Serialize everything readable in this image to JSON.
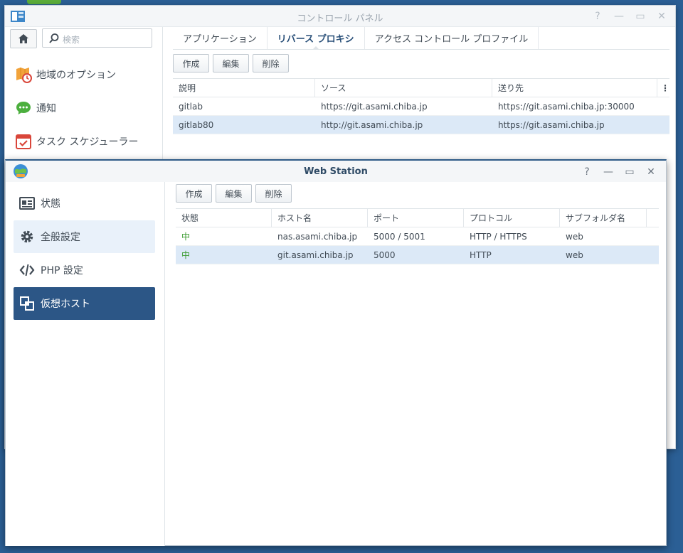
{
  "control_panel": {
    "title": "コントロール パネル",
    "search_placeholder": "検索",
    "window_controls": [
      "?",
      "—",
      "▭",
      "✕"
    ],
    "sidebar": [
      {
        "label": "地域のオプション",
        "icon": "region-options-icon"
      },
      {
        "label": "通知",
        "icon": "notification-icon"
      },
      {
        "label": "タスク スケジューラー",
        "icon": "task-scheduler-icon"
      }
    ],
    "tabs": [
      {
        "label": "アプリケーション"
      },
      {
        "label": "リバース プロキシ",
        "active": true
      },
      {
        "label": "アクセス コントロール プロファイル"
      }
    ],
    "toolbar": {
      "create": "作成",
      "edit": "編集",
      "delete": "削除"
    },
    "table": {
      "headers": [
        "説明",
        "ソース",
        "送り先"
      ],
      "rows": [
        [
          "gitlab",
          "https://git.asami.chiba.jp",
          "https://git.asami.chiba.jp:30000"
        ],
        [
          "gitlab80",
          "http://git.asami.chiba.jp",
          "https://git.asami.chiba.jp"
        ]
      ],
      "selected_row": 1,
      "menu_glyph": "⋮"
    }
  },
  "web_station": {
    "title": "Web Station",
    "window_controls": [
      "?",
      "—",
      "▭",
      "✕"
    ],
    "sidebar": [
      {
        "label": "状態",
        "icon": "status-icon"
      },
      {
        "label": "全般設定",
        "icon": "gear-icon"
      },
      {
        "label": "PHP 設定",
        "icon": "code-icon"
      },
      {
        "label": "仮想ホスト",
        "icon": "virtual-host-icon",
        "active": true
      }
    ],
    "toolbar": {
      "create": "作成",
      "edit": "編集",
      "delete": "削除"
    },
    "table": {
      "headers": [
        "状態",
        "ホスト名",
        "ポート",
        "プロトコル",
        "サブフォルダ名"
      ],
      "rows": [
        [
          "中",
          "nas.asami.chiba.jp",
          "5000 / 5001",
          "HTTP / HTTPS",
          "web"
        ],
        [
          "中",
          "git.asami.chiba.jp",
          "5000",
          "HTTP",
          "web"
        ]
      ],
      "selected_row": 1
    }
  }
}
